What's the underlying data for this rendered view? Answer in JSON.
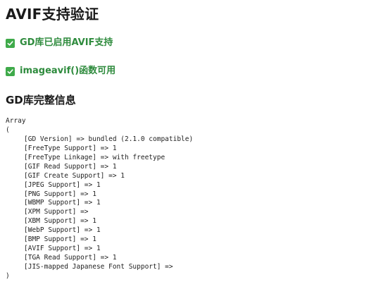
{
  "page": {
    "title": "AVIF支持验证",
    "checks": [
      {
        "label": "GD库已启用AVIF支持",
        "icon": "check-mark-icon",
        "color": "#3faa4a"
      },
      {
        "label": "imageavif()函数可用",
        "icon": "check-mark-icon",
        "color": "#3faa4a"
      }
    ],
    "section_title": "GD库完整信息",
    "dump": {
      "open": "Array",
      "paren_open": "(",
      "lines": [
        "[GD Version] => bundled (2.1.0 compatible)",
        "[FreeType Support] => 1",
        "[FreeType Linkage] => with freetype",
        "[GIF Read Support] => 1",
        "[GIF Create Support] => 1",
        "[JPEG Support] => 1",
        "[PNG Support] => 1",
        "[WBMP Support] => 1",
        "[XPM Support] =>",
        "[XBM Support] => 1",
        "[WebP Support] => 1",
        "[BMP Support] => 1",
        "[AVIF Support] => 1",
        "[TGA Read Support] => 1",
        "[JIS-mapped Japanese Font Support] =>"
      ],
      "paren_close": ")"
    }
  }
}
